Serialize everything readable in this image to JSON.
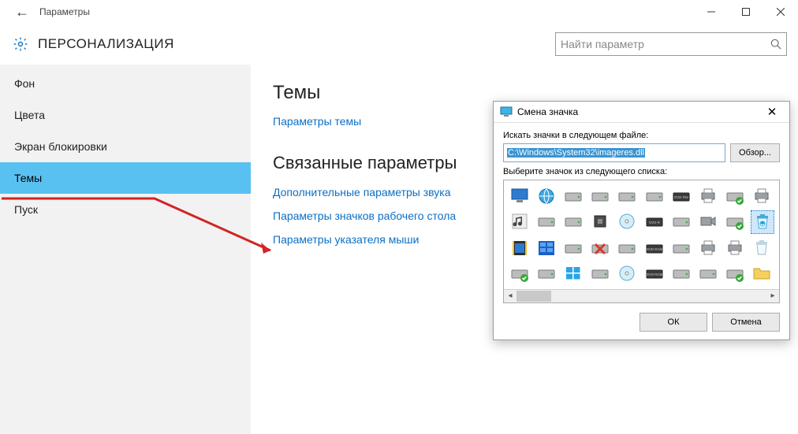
{
  "titlebar": {
    "caption": "Параметры"
  },
  "category": "ПЕРСОНАЛИЗАЦИЯ",
  "search": {
    "placeholder": "Найти параметр"
  },
  "sidebar": {
    "items": [
      {
        "label": "Фон"
      },
      {
        "label": "Цвета"
      },
      {
        "label": "Экран блокировки"
      },
      {
        "label": "Темы",
        "selected": true
      },
      {
        "label": "Пуск"
      }
    ]
  },
  "content": {
    "heading1": "Темы",
    "link1": "Параметры темы",
    "heading2": "Связанные параметры",
    "link2": "Дополнительные параметры звука",
    "link3": "Параметры значков рабочего стола",
    "link4": "Параметры указателя мыши"
  },
  "dialog": {
    "title": "Смена значка",
    "label_path": "Искать значки в следующем файле:",
    "path_value": "C:\\Windows\\System32\\imageres.dll",
    "browse": "Обзор...",
    "label_list": "Выберите значок из следующего списка:",
    "ok": "ОК",
    "cancel": "Отмена"
  }
}
